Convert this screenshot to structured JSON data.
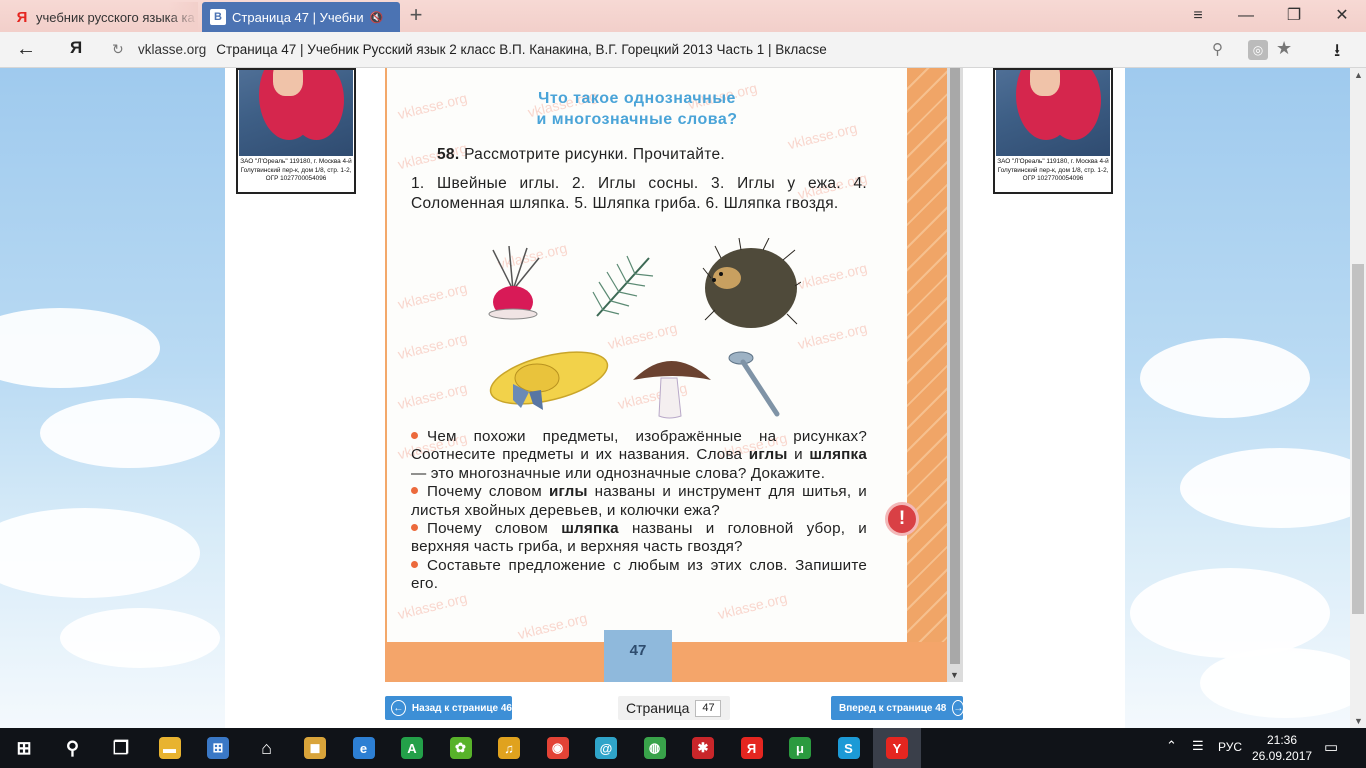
{
  "browser": {
    "tabs": [
      {
        "label": "учебник русского языка ка",
        "favicon": "Я",
        "active": false
      },
      {
        "label": "Страница 47 | Учебни",
        "favicon": "В",
        "active": true,
        "mute_icon": "speaker-muted-icon"
      }
    ],
    "new_tab": "+",
    "window_controls": {
      "menu": "≡",
      "minimize": "—",
      "restore": "❐",
      "close": "✕"
    },
    "address": {
      "host": "vklasse.org",
      "title": "Страница 47 | Учебник Русский язык 2 класс В.П. Канакина, В.Г. Горецкий 2013 Часть 1 | Вкласse"
    }
  },
  "ads": {
    "caption": "ЗАО \"Л'Ореаль\" 119180, г. Москва 4-й Голутвинский пер-к, дом 1/8, стр. 1-2, ОГР 1027700054096"
  },
  "book": {
    "title_line1": "Что такое однозначные",
    "title_line2": "и многозначные слова?",
    "exercise_number": "58.",
    "exercise_instruction": "Рассмотрите рисунки. Прочитайте.",
    "exercise_items": "1. Швейные иглы. 2. Иглы сосны. 3. Иглы у ежа. 4. Соломенная шляпка. 5. Шляпка гриба. 6. Шляпка гвоздя.",
    "questions": [
      {
        "parts": [
          {
            "t": "Чем похожи предметы, изображённые на рисунках? Соотнесите предметы и их названия. Слова "
          },
          {
            "t": "иглы",
            "b": true
          },
          {
            "t": " и "
          },
          {
            "t": "шляпка",
            "b": true
          },
          {
            "t": " — это многозначные или однозначные слова? Докажите."
          }
        ]
      },
      {
        "parts": [
          {
            "t": "Почему словом "
          },
          {
            "t": "иглы",
            "b": true
          },
          {
            "t": " названы и инструмент для шитья, и листья хвойных деревьев, и колючки ежа?"
          }
        ]
      },
      {
        "parts": [
          {
            "t": "Почему словом "
          },
          {
            "t": "шляпка",
            "b": true
          },
          {
            "t": " названы и головной убор, и верхняя часть гриба, и верхняя часть гвоздя?"
          }
        ]
      },
      {
        "parts": [
          {
            "t": "Составьте предложение с любым из этих слов. Запишите его."
          }
        ]
      }
    ],
    "watermark": "vklasse.org",
    "page_number": "47",
    "warning_mark": "!"
  },
  "nav": {
    "prev_label": "Назад к странице 46",
    "next_label": "Вперед к странице 48",
    "page_label": "Страница",
    "page_value": "47"
  },
  "taskbar": {
    "apps": [
      "windows-start-icon",
      "search-icon",
      "task-view-icon",
      "file-explorer-icon",
      "store-icon",
      "home-icon",
      "app-icon",
      "edge-icon",
      "a-app-icon",
      "icq-icon",
      "music-icon",
      "chrome-icon",
      "at-icon",
      "game-icon",
      "app-red-icon",
      "yandex-browser-icon",
      "utorrent-icon",
      "skype-icon",
      "yandex-icon"
    ],
    "lang": "РУС",
    "time": "21:36",
    "date": "26.09.2017"
  },
  "colors": {
    "tab_bar": "#f2cfca",
    "active_tab": "#4b73b3",
    "sky": "#b9daf3",
    "book_orange": "#f3a86a",
    "title_blue": "#4aa4d8",
    "nav_button": "#3d8fd6",
    "taskbar": "#101318"
  }
}
